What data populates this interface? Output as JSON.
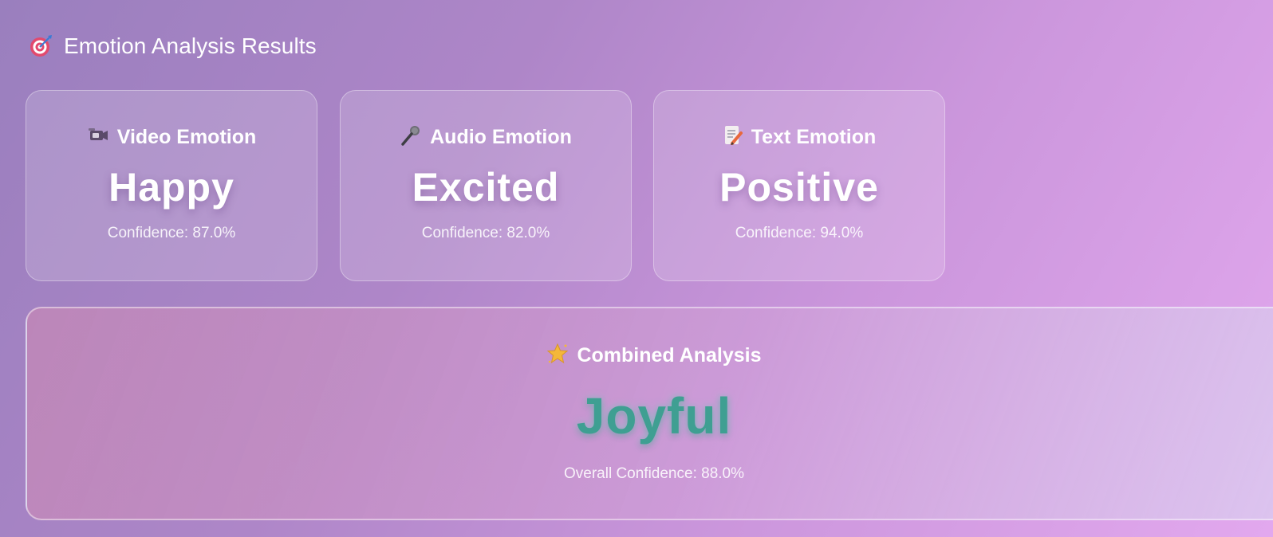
{
  "header": {
    "icon": "target-icon",
    "title": "Emotion Analysis Results"
  },
  "cards": [
    {
      "icon": "video-camera-icon",
      "label": "Video Emotion",
      "emotion": "Happy",
      "confidence_text": "Confidence: 87.0%"
    },
    {
      "icon": "microphone-icon",
      "label": "Audio Emotion",
      "emotion": "Excited",
      "confidence_text": "Confidence: 82.0%"
    },
    {
      "icon": "memo-icon",
      "label": "Text Emotion",
      "emotion": "Positive",
      "confidence_text": "Confidence: 94.0%"
    }
  ],
  "combined": {
    "icon": "star-icon",
    "label": "Combined Analysis",
    "emotion": "Joyful",
    "confidence_text": "Overall Confidence: 88.0%"
  },
  "colors": {
    "accent_emotion": "#3f9f92",
    "background_start": "#9a7fbe",
    "background_end": "#e2a8ee"
  }
}
